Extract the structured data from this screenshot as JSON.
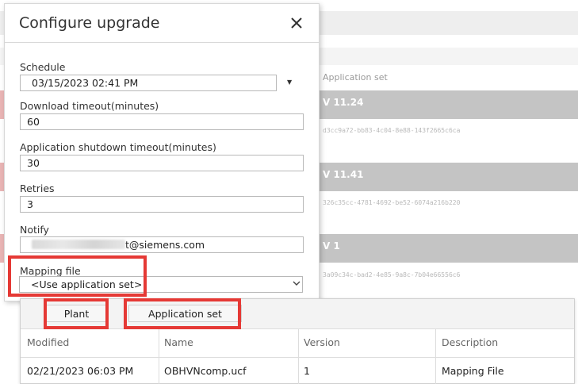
{
  "dialog": {
    "title": "Configure upgrade",
    "close_icon": "close-icon"
  },
  "form": {
    "schedule_label": "Schedule",
    "schedule_value": "03/15/2023 02:41 PM",
    "download_timeout_label": "Download timeout(minutes)",
    "download_timeout_value": "60",
    "shutdown_timeout_label": "Application shutdown timeout(minutes)",
    "shutdown_timeout_value": "30",
    "retries_label": "Retries",
    "retries_value": "3",
    "notify_label": "Notify",
    "notify_value_visible": "t@siemens.com",
    "mapping_file_label": "Mapping file",
    "mapping_file_value": "<Use application set>"
  },
  "mapping_panel": {
    "tabs": [
      "Plant",
      "Application set"
    ],
    "columns": [
      "Modified",
      "Name",
      "Version",
      "Description"
    ],
    "rows": [
      [
        "02/21/2023 06:03 PM",
        "OBHVNcomp.ucf",
        "1",
        "Mapping File"
      ]
    ]
  },
  "background": {
    "column_header": "Application set",
    "bands": [
      {
        "label": "V 11.24",
        "guid": "d3cc9a72-bb83-4c04-8e88-143f2665c6ca"
      },
      {
        "label": "V 11.41",
        "guid": "326c35cc-4781-4692-be52-6074a216b220"
      },
      {
        "label": "V 1",
        "guid": "3a09c34c-bad2-4e85-9a8c-7b04e66556c6"
      }
    ]
  },
  "colors": {
    "highlight_red": "#e53935",
    "band_gray": "#c4c4c4"
  }
}
